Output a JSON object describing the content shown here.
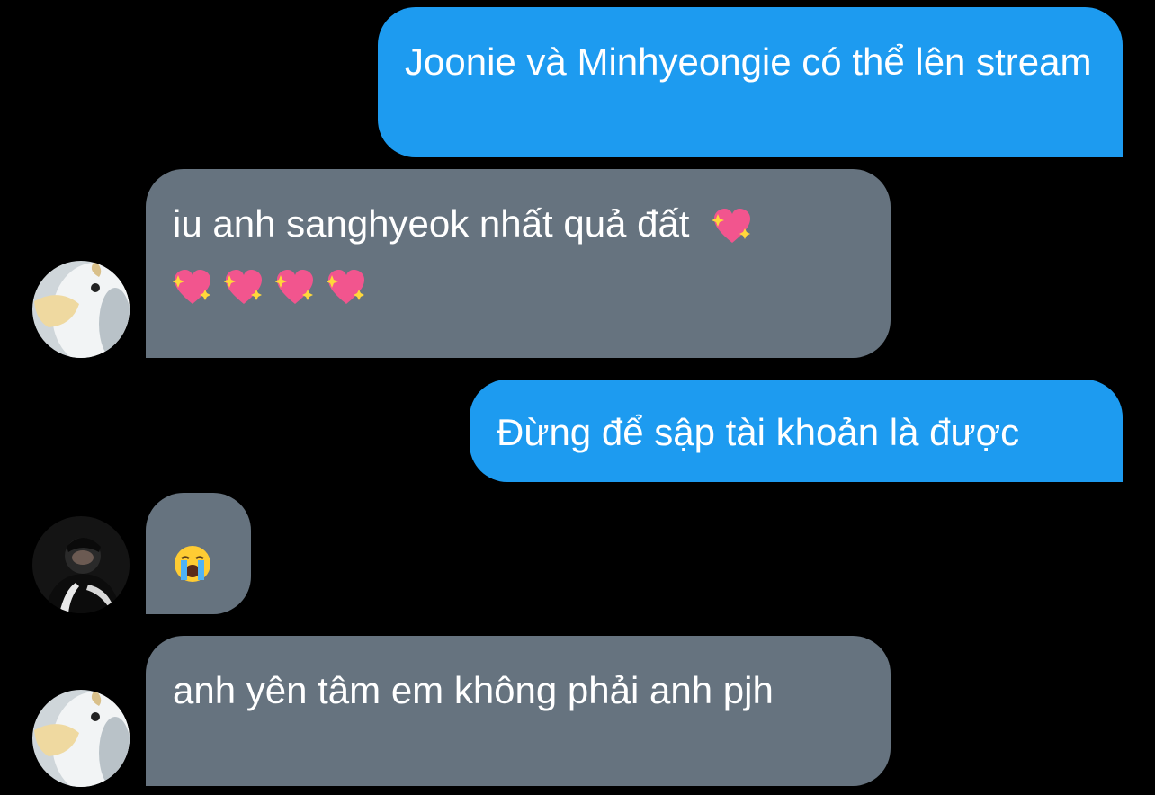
{
  "conversation": {
    "messages": [
      {
        "direction": "sent",
        "text": "Joonie và Minhyeongie có thể lên stream"
      },
      {
        "direction": "received",
        "avatar": "penguin-plush-avatar",
        "text": "iu anh sanghyeok nhất quả đất",
        "emojis": [
          "sparkling-heart",
          "sparkling-heart",
          "sparkling-heart",
          "sparkling-heart",
          "sparkling-heart"
        ]
      },
      {
        "direction": "sent",
        "text": "Đừng để sập tài khoản là được"
      },
      {
        "direction": "received",
        "avatar": "person-dark-avatar",
        "emojis": [
          "loudly-crying-face"
        ]
      },
      {
        "direction": "received",
        "avatar": "penguin-plush-avatar",
        "text": "anh yên tâm em không phải anh pjh"
      }
    ]
  },
  "colors": {
    "background": "#000000",
    "sent_bubble": "#1d9bf0",
    "received_bubble": "#66737f",
    "text": "#ffffff"
  }
}
